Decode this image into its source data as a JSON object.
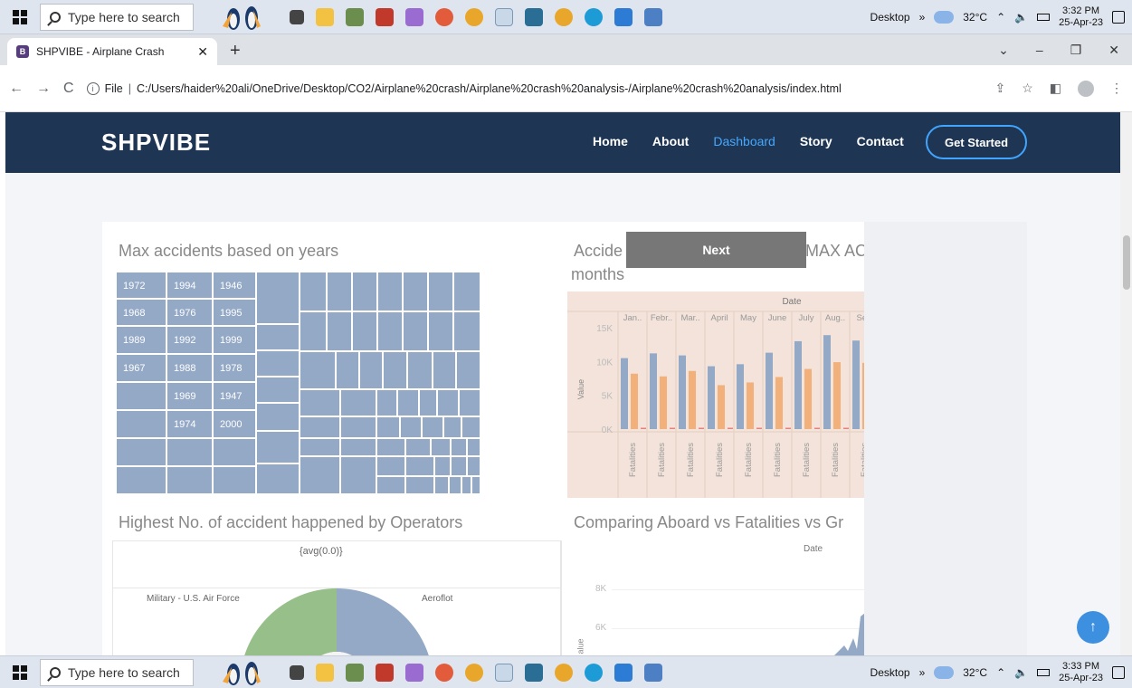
{
  "taskbar": {
    "search_placeholder": "Type here to search",
    "desktop_label": "Desktop",
    "chevron": "»",
    "weather": "32°C",
    "top_time": "3:32 PM",
    "top_date": "25-Apr-23",
    "bottom_time": "3:33 PM",
    "bottom_date": "25-Apr-23"
  },
  "browser": {
    "tab_title": "SHPVIBE - Airplane Crash",
    "tab_favicon": "B",
    "url_prefix": "File",
    "url": "C:/Users/haider%20ali/OneDrive/Desktop/CO2/Airplane%20crash/Airplane%20crash%20analysis-/Airplane%20crash%20analysis/index.html"
  },
  "site": {
    "brand": "SHPVIBE",
    "menu": [
      "Home",
      "About",
      "Dashboard",
      "Story",
      "Contact"
    ],
    "cta": "Get Started"
  },
  "dashboard": {
    "treemap_title": "Max accidents based on years",
    "treemap_labels": [
      "1972",
      "1994",
      "1946",
      "1968",
      "1976",
      "1995",
      "1989",
      "1992",
      "1999",
      "1967",
      "1988",
      "1978",
      "1969",
      "1947",
      "1974",
      "2000"
    ],
    "bar_title_left": "Accide",
    "bar_title_right": "MAX AC",
    "bar_title_line2": "months",
    "next_label": "Next",
    "bar_header": "Date",
    "bar_months": [
      "Jan..",
      "Febr..",
      "Mar..",
      "April",
      "May",
      "June",
      "July",
      "Aug..",
      "Sep"
    ],
    "bar_yticks": [
      "15K",
      "10K",
      "5K",
      "0K"
    ],
    "bar_ylabel": "Value",
    "bar_xlabel": "Fatalities",
    "donut_title": "Highest No. of accident happened by Operators",
    "donut_header": "{avg(0.0)}",
    "donut_label_left": "Military - U.S. Air Force",
    "donut_label_right": "Aeroflot",
    "line_title": "Comparing Aboard vs Fatalities vs Gr",
    "line_header": "Date",
    "line_yticks": [
      "8K",
      "6K"
    ],
    "line_ylabel": "alue"
  },
  "chart_data": [
    {
      "type": "bar",
      "title": "",
      "categories": [
        "Jan..",
        "Febr..",
        "Mar..",
        "April",
        "May",
        "June",
        "July",
        "Aug..",
        "Sep"
      ],
      "series": [
        {
          "values": [
            10500,
            11200,
            10900,
            9300,
            9600,
            11300,
            13000,
            13900,
            13100
          ]
        },
        {
          "values": [
            8200,
            7800,
            8600,
            6500,
            6900,
            7700,
            8900,
            9900,
            9800
          ]
        },
        {
          "values": [
            200,
            200,
            200,
            200,
            200,
            200,
            200,
            200,
            200
          ]
        }
      ],
      "ylim": [
        0,
        15000
      ],
      "colors": [
        "#94a9c6",
        "#f2b07a",
        "#e7837f"
      ]
    }
  ],
  "colors": {
    "nav_bg": "#1e3553",
    "accent": "#45a8ff",
    "treemap": "#94a9c6",
    "bar_orange": "#f2b07a",
    "donut_green": "#96bf8a"
  }
}
